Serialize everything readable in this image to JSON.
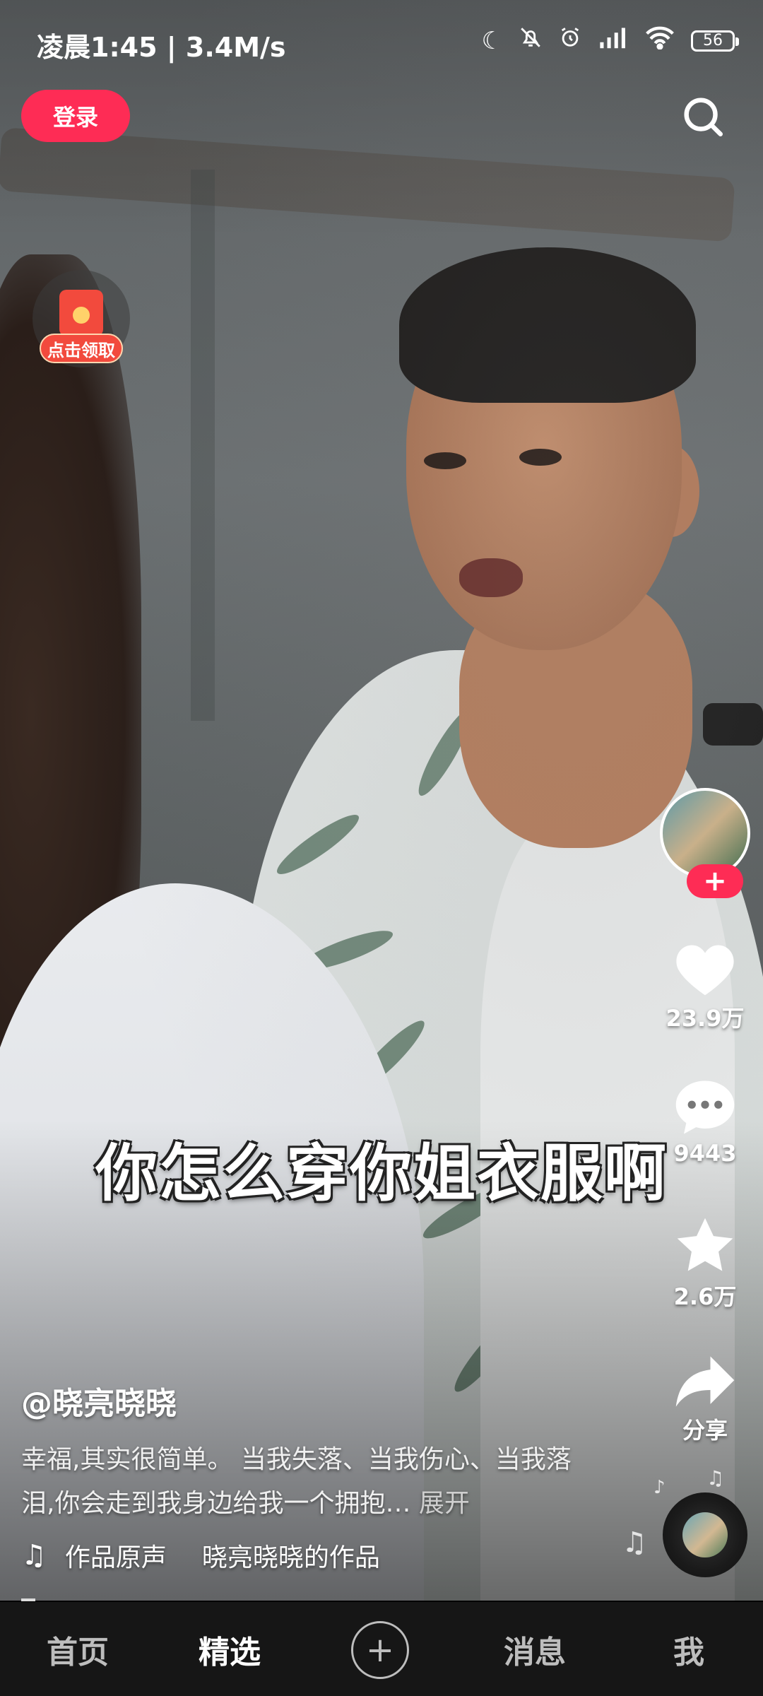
{
  "status_bar": {
    "time": "凌晨1:45",
    "speed": "3.4M/s",
    "battery": "56"
  },
  "header": {
    "login_label": "登录"
  },
  "red_packet": {
    "label": "点击领取"
  },
  "video": {
    "subtitle": "你怎么穿你姐衣服啊"
  },
  "actions": {
    "like_count": "23.9万",
    "comment_count": "9443",
    "favorite_count": "2.6万",
    "share_label": "分享",
    "follow_symbol": "+"
  },
  "post": {
    "author": "@晓亮晓晓",
    "description": "幸福,其实很简单。 当我失落、当我伤心、当我落泪,你会走到我身边给我一个拥抱…",
    "expand_label": "展开",
    "music_title": "作品原声",
    "music_author": "晓亮晓晓的作品"
  },
  "bottom_nav": {
    "home": "首页",
    "featured": "精选",
    "plus": "+",
    "messages": "消息",
    "me": "我"
  },
  "colors": {
    "accent": "#fe2c55",
    "nav_bg": "#161616"
  }
}
